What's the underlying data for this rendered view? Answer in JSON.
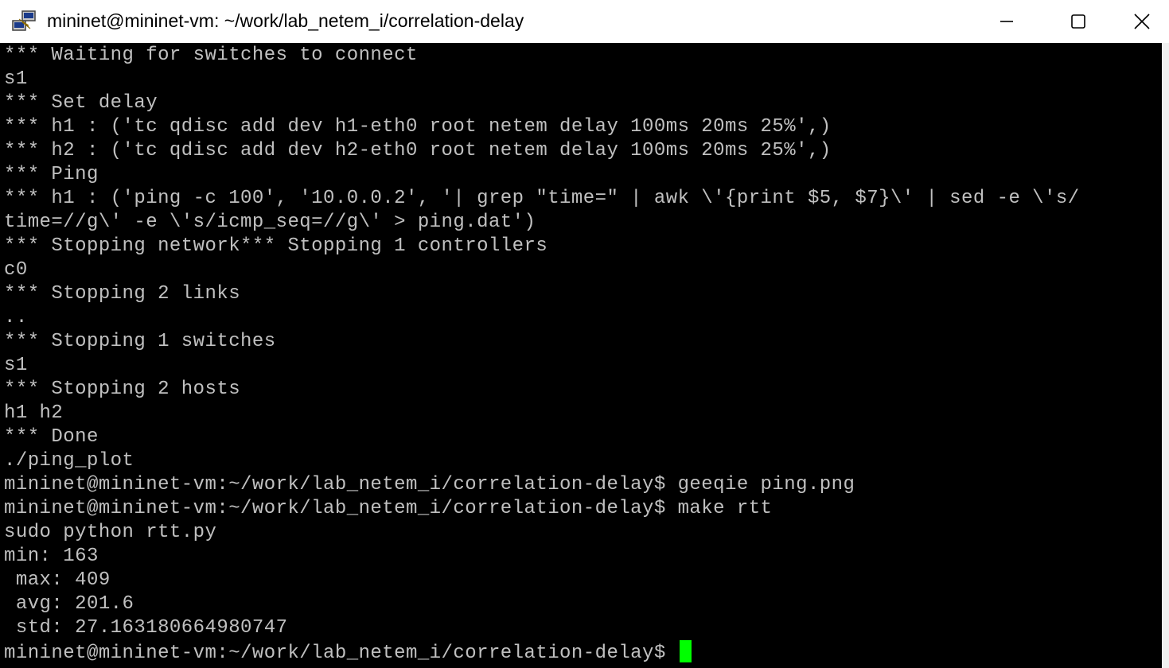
{
  "window": {
    "title": "mininet@mininet-vm: ~/work/lab_netem_i/correlation-delay",
    "app_icon": "putty-icon",
    "minimize_icon": "minimize-icon",
    "maximize_icon": "maximize-icon",
    "close_icon": "close-icon"
  },
  "terminal": {
    "lines": [
      "*** Waiting for switches to connect",
      "s1",
      "*** Set delay",
      "*** h1 : ('tc qdisc add dev h1-eth0 root netem delay 100ms 20ms 25%',)",
      "*** h2 : ('tc qdisc add dev h2-eth0 root netem delay 100ms 20ms 25%',)",
      "*** Ping",
      "*** h1 : ('ping -c 100', '10.0.0.2', '| grep \"time=\" | awk \\'{print $5, $7}\\' | sed -e \\'s/",
      "time=//g\\' -e \\'s/icmp_seq=//g\\' > ping.dat')",
      "*** Stopping network*** Stopping 1 controllers",
      "c0",
      "*** Stopping 2 links",
      "..",
      "*** Stopping 1 switches",
      "s1",
      "*** Stopping 2 hosts",
      "h1 h2",
      "*** Done",
      "./ping_plot",
      "mininet@mininet-vm:~/work/lab_netem_i/correlation-delay$ geeqie ping.png",
      "mininet@mininet-vm:~/work/lab_netem_i/correlation-delay$ make rtt",
      "sudo python rtt.py",
      "min: 163",
      " max: 409",
      " avg: 201.6",
      " std: 27.163180664980747"
    ],
    "prompt": "mininet@mininet-vm:~/work/lab_netem_i/correlation-delay$ ",
    "cursor_color": "#00ff00",
    "text_color": "#c0c0c0",
    "background_color": "#000000"
  }
}
